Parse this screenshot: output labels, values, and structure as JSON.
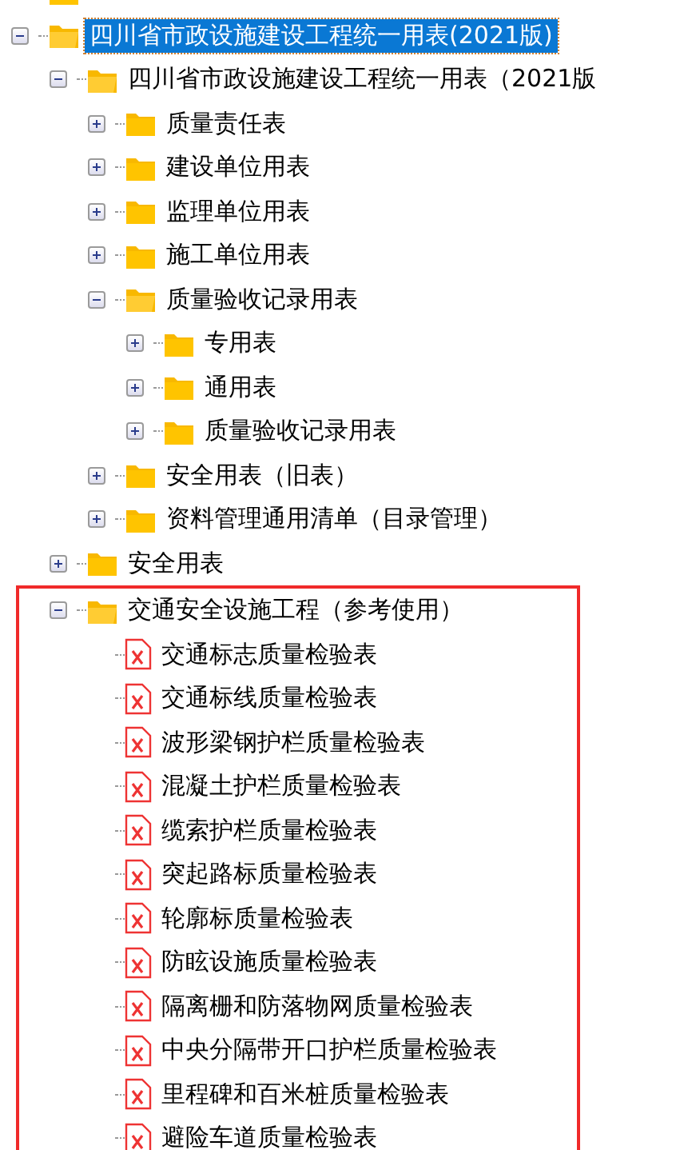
{
  "tree": [
    {
      "kind": "folder"
    },
    {
      "kind": "folder",
      "label": "四川省市政设施建设工程统一用表(2021版)",
      "expanded": true,
      "selected": true,
      "children": [
        {
          "kind": "folder",
          "label": "四川省市政设施建设工程统一用表（2021版",
          "expanded": true,
          "selected": false,
          "children": [
            {
              "kind": "folder",
              "label": "质量责任表",
              "expanded": false,
              "selected": false
            },
            {
              "kind": "folder",
              "label": "建设单位用表",
              "expanded": false,
              "selected": false
            },
            {
              "kind": "folder",
              "label": "监理单位用表",
              "expanded": false,
              "selected": false
            },
            {
              "kind": "folder",
              "label": "施工单位用表",
              "expanded": false,
              "selected": false
            },
            {
              "kind": "folder",
              "label": "质量验收记录用表",
              "expanded": true,
              "selected": false,
              "children": [
                {
                  "kind": "folder",
                  "label": "专用表",
                  "expanded": false,
                  "selected": false
                },
                {
                  "kind": "folder",
                  "label": "通用表",
                  "expanded": false,
                  "selected": false
                },
                {
                  "kind": "folder",
                  "label": "质量验收记录用表",
                  "expanded": false,
                  "selected": false
                }
              ]
            },
            {
              "kind": "folder",
              "label": "安全用表（旧表）",
              "expanded": false,
              "selected": false
            },
            {
              "kind": "folder",
              "label": "资料管理通用清单（目录管理）",
              "expanded": false,
              "selected": false
            }
          ]
        },
        {
          "kind": "folder",
          "label": "安全用表",
          "expanded": false,
          "selected": false
        },
        {
          "kind": "folder",
          "label": "交通安全设施工程（参考使用）",
          "expanded": true,
          "selected": false,
          "highlighted": true,
          "children": [
            {
              "kind": "file",
              "label": "交通标志质量检验表",
              "selected": false
            },
            {
              "kind": "file",
              "label": "交通标线质量检验表",
              "selected": false
            },
            {
              "kind": "file",
              "label": "波形梁钢护栏质量检验表",
              "selected": false
            },
            {
              "kind": "file",
              "label": "混凝土护栏质量检验表",
              "selected": false
            },
            {
              "kind": "file",
              "label": "缆索护栏质量检验表",
              "selected": false
            },
            {
              "kind": "file",
              "label": "突起路标质量检验表",
              "selected": false
            },
            {
              "kind": "file",
              "label": "轮廓标质量检验表",
              "selected": false
            },
            {
              "kind": "file",
              "label": "防眩设施质量检验表",
              "selected": false
            },
            {
              "kind": "file",
              "label": "隔离栅和防落物网质量检验表",
              "selected": false
            },
            {
              "kind": "file",
              "label": "中央分隔带开口护栏质量检验表",
              "selected": false
            },
            {
              "kind": "file",
              "label": "里程碑和百米桩质量检验表",
              "selected": false
            },
            {
              "kind": "file",
              "label": "避险车道质量检验表",
              "selected": false
            }
          ]
        }
      ]
    }
  ]
}
